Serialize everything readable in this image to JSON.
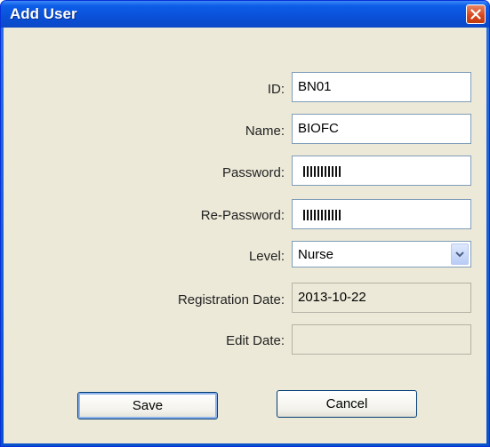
{
  "window": {
    "title": "Add User",
    "close_icon": "close-icon"
  },
  "form": {
    "id_label": "ID:",
    "id_value": "BN01",
    "name_label": "Name:",
    "name_value": "BIOFC",
    "password_label": "Password:",
    "repassword_label": "Re-Password:",
    "level_label": "Level:",
    "level_value": "Nurse",
    "registration_label": "Registration Date:",
    "registration_value": "2013-10-22",
    "edit_label": "Edit Date:",
    "edit_value": ""
  },
  "buttons": {
    "save_label": "Save",
    "cancel_label": "Cancel"
  },
  "colors": {
    "titlebar": "#0a50d8",
    "client_bg": "#ece9d8",
    "close_button": "#d5451b"
  }
}
